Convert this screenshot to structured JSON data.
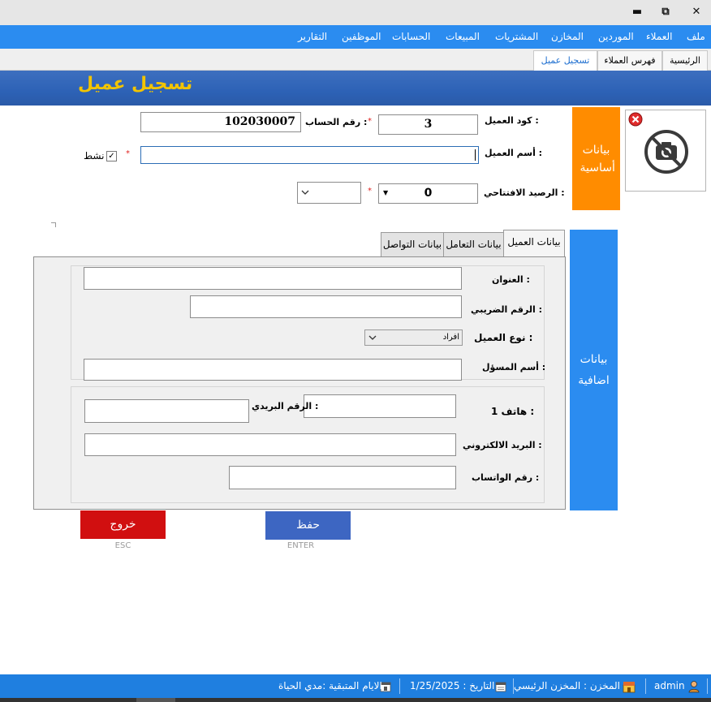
{
  "window": {
    "minimize": "▬",
    "restore": "⧉",
    "close": "✕"
  },
  "menu": [
    "ملف",
    "العملاء",
    "الموردين",
    "المخازن",
    "المشتريات",
    "المبيعات",
    "الحسابات",
    "الموظفين",
    "التقارير"
  ],
  "tabs": [
    "الرئيسية",
    "فهرس العملاء",
    "تسجيل عميل"
  ],
  "page_title": "تسجيل عميل",
  "form": {
    "code_label": "كود العميل :",
    "code_value": "3",
    "account_label": "رقم الحساب :",
    "account_value": "102030007",
    "name_label": "أسم العميل :",
    "name_value": "",
    "active_label": "نشط",
    "active_checked": true,
    "opening_label": "الرصيد الافتتاحي :",
    "opening_value": "0",
    "required_mark": "*"
  },
  "sections": {
    "basic": "بيانات أساسية",
    "extra": "بيانات اضافية"
  },
  "subtabs": [
    "بيانات العميل",
    "بيانات التعامل",
    "بيانات التواصل"
  ],
  "client_tab": {
    "address_label": "العنوان :",
    "tax_label": "الرقم الضريبي :",
    "type_label": "نوع العميل :",
    "type_value": "افراد",
    "manager_label": "أسم المسؤل :",
    "phone_label": "هاتف 1 :",
    "postal_label": "الرقم البريدي :",
    "email_label": "البريد الالكتروني :",
    "whatsapp_label": "رقم الواتساب :"
  },
  "buttons": {
    "exit": "خروج",
    "exit_hint": "ESC",
    "save": "حفظ",
    "save_hint": "ENTER"
  },
  "status": {
    "user": "admin",
    "store": "المخزن : المخزن الرئيسي",
    "date": "التاريخ : 1/25/2025",
    "days": "الايام المتبقية :مدي الحياة"
  },
  "colors": {
    "menu": "#2b8cf0",
    "orange": "#ff8c00",
    "exit": "#d10f10",
    "save": "#3d66c2",
    "title": "#f2c400"
  }
}
